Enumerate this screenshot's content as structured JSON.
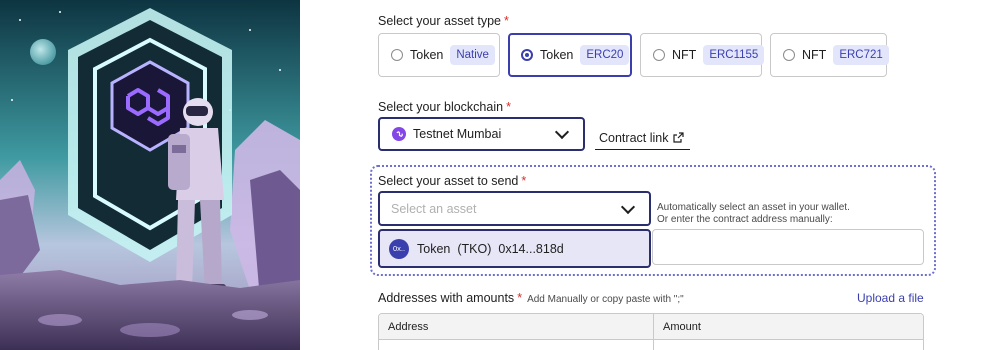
{
  "colors": {
    "accent": "#3b3fae",
    "chip_bg": "#e3e6fb",
    "required": "#d32f2f",
    "dotted_border": "#6f6fd0",
    "polygon_purple": "#8247e5"
  },
  "asset_type": {
    "label": "Select your asset type",
    "required_mark": "*",
    "options": [
      {
        "label": "Token",
        "chip": "Native",
        "selected": false
      },
      {
        "label": "Token",
        "chip": "ERC20",
        "selected": true
      },
      {
        "label": "NFT",
        "chip": "ERC1155",
        "selected": false
      },
      {
        "label": "NFT",
        "chip": "ERC721",
        "selected": false
      }
    ]
  },
  "blockchain": {
    "label": "Select your blockchain",
    "required_mark": "*",
    "selected": "Testnet Mumbai",
    "icon": "polygon-icon",
    "contract_link": "Contract link"
  },
  "asset_send": {
    "label": "Select your asset to send",
    "required_mark": "*",
    "placeholder": "Select an asset",
    "helper_line1": "Automatically select an asset in your wallet.",
    "helper_line2": "Or enter the contract address manually:",
    "dropdown_item": {
      "icon_text": "0x..",
      "name": "Token",
      "symbol": "(TKO)",
      "address": "0x14...818d"
    }
  },
  "addresses": {
    "label": "Addresses with amounts",
    "required_mark": "*",
    "hint": "Add Manually or copy paste with \";\"",
    "upload": "Upload a file",
    "columns": [
      "Address",
      "Amount"
    ]
  }
}
